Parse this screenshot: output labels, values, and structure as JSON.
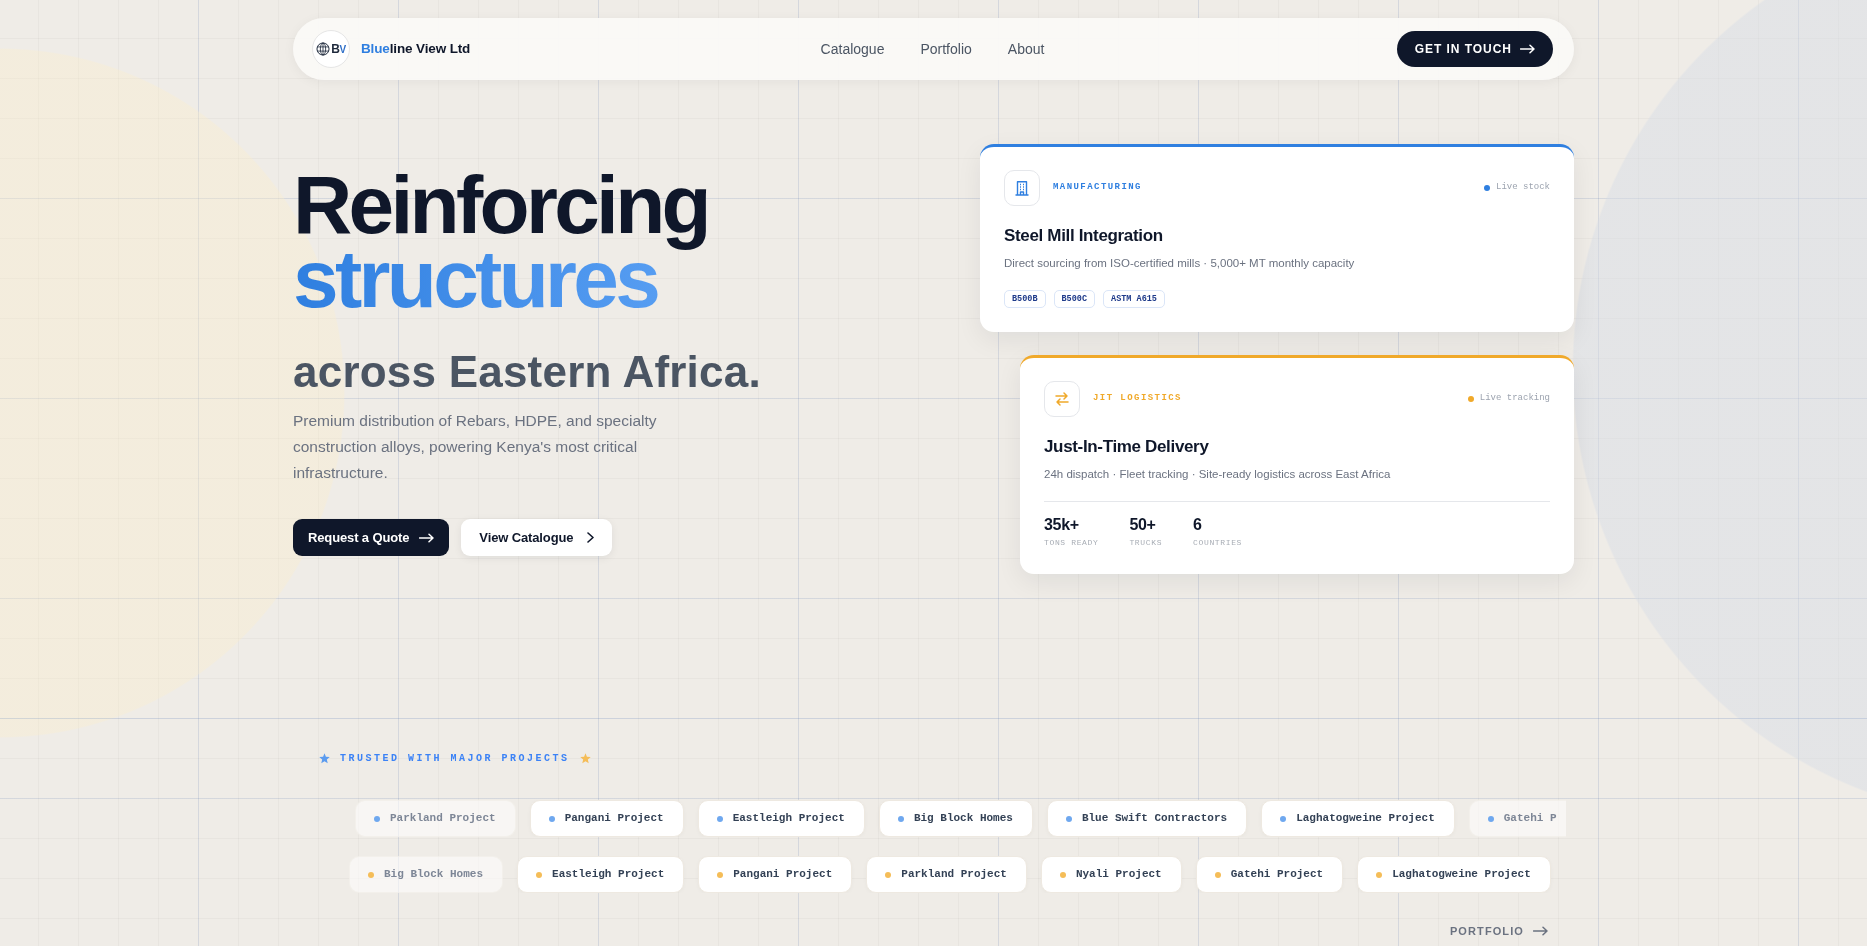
{
  "navbar": {
    "logo": {
      "letters": "BV"
    },
    "brand": {
      "accent": "Blue",
      "rest": "line View Ltd"
    },
    "links": [
      {
        "label": "Catalogue"
      },
      {
        "label": "Portfolio"
      },
      {
        "label": "About"
      }
    ],
    "cta": {
      "label": "GET IN TOUCH"
    }
  },
  "hero": {
    "title_lines": [
      {
        "text": "Reinforcing",
        "kind": "plain"
      },
      {
        "text": "structures",
        "kind": "accent"
      }
    ],
    "subtitle": "across Eastern Africa.",
    "description": "Premium distribution of Rebars, HDPE, and specialty construction alloys, powering Kenya's most critical infrastructure.",
    "buttons": [
      {
        "label": "Request a Quote",
        "kind": "primary"
      },
      {
        "label": "View Catalogue",
        "kind": "secondary"
      }
    ]
  },
  "cards": [
    {
      "kind": "manufacturing",
      "color": "#2f7fe0",
      "label": "MANUFACTURING",
      "status": "Live stock",
      "title": "Steel Mill Integration",
      "description": "Direct sourcing from ISO-certified mills · 5,000+ MT monthly capacity",
      "tags": [
        "B500B",
        "B500C",
        "ASTM A615"
      ]
    },
    {
      "kind": "logistics",
      "color": "#f0a92a",
      "label": "JIT LOGISTICS",
      "status": "Live tracking",
      "title": "Just-In-Time Delivery",
      "description": "24h dispatch · Fleet tracking · Site-ready logistics across East Africa",
      "stats": [
        {
          "value": "35k+",
          "label": "TONS READY"
        },
        {
          "value": "50+",
          "label": "TRUCKS"
        },
        {
          "value": "6",
          "label": "COUNTRIES"
        }
      ]
    }
  ],
  "trusted": {
    "heading": "TRUSTED WITH MAJOR PROJECTS",
    "rows": [
      {
        "color": "#6fa8ef",
        "projects": [
          "Parkland Project",
          "Pangani Project",
          "Eastleigh Project",
          "Big Block Homes",
          "Blue Swift Contractors",
          "Laghatogweine Project",
          "Gatehi P"
        ]
      },
      {
        "color": "#f5bd58",
        "projects": [
          "Big Block Homes",
          "Eastleigh Project",
          "Pangani Project",
          "Parkland Project",
          "Nyali Project",
          "Gatehi Project",
          "Laghatogweine Project"
        ]
      }
    ]
  },
  "portfolio_link": {
    "label": "PORTFOLIO"
  }
}
